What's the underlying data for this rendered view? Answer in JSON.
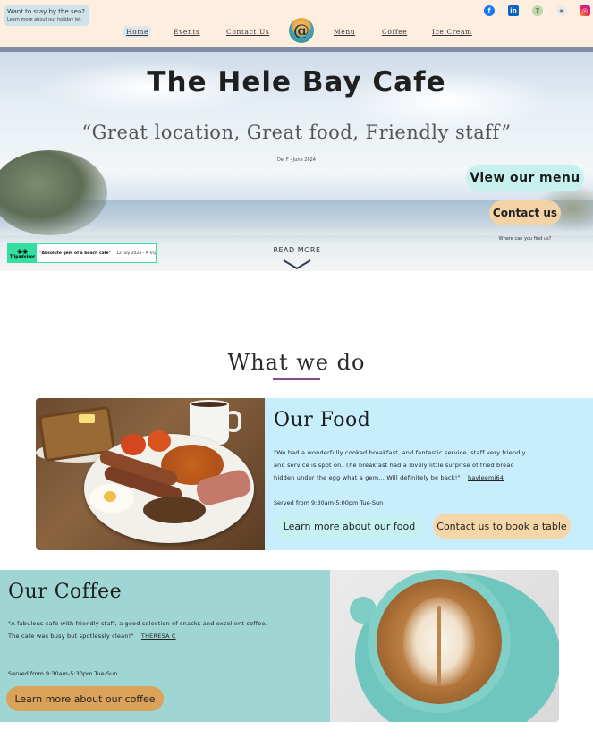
{
  "header": {
    "promo": {
      "title": "Want to stay by the sea?",
      "subtitle": "Learn more about our holiday let."
    },
    "nav": {
      "home": "Home",
      "events": "Events",
      "contact": "Contact Us",
      "menu": "Menu",
      "coffee": "Coffee",
      "ice_cream": "Ice Cream"
    },
    "logo_glyph": "@",
    "social_icons": [
      "facebook-icon",
      "linkedin-icon",
      "help-icon",
      "tripadvisor-icon",
      "instagram-icon"
    ]
  },
  "hero": {
    "title": "The Hele Bay Cafe",
    "quote": "“Great location, Great food, Friendly staff”",
    "cite": "Del F - June 2024",
    "view_menu": "View our menu",
    "contact": "Contact us",
    "find_us": "Where can you find us?",
    "read_more": "READ MORE",
    "tripadvisor": {
      "brand": "Tripadvisor",
      "quote": "\"Absolute gem of a beach cafe\"",
      "date": "12 July 2024 - A Tripa"
    }
  },
  "what_we_do": {
    "title": "What we do"
  },
  "food": {
    "heading": "Our Food",
    "review_lines": [
      "\"We had a wonderfully cooked breakfast, and fantastic service, staff very friendly",
      "and service is spot on. The breakfast had a lovely little surprise of fried bread",
      "hidden under the egg what a gem... Will definitely be back!\""
    ],
    "reviewer": "hayleemj64",
    "served": "Served from 9:30am-5:00pm Tue-Sun",
    "learn_more": "Learn more about our food",
    "book": "Contact us to book a table"
  },
  "coffee": {
    "heading": "Our Coffee",
    "review_lines": [
      "\"A fabulous cafe with friendly staff, a good selection of snacks and excellent coffee.",
      "The cafe was busy but spotlessly clean!\""
    ],
    "reviewer": "THERESA C",
    "served": "Served from 9:30am-5:30pm Tue-Sun",
    "learn_more": "Learn more about our coffee"
  },
  "colors": {
    "header_bg": "#fdeee0",
    "header_bar": "#7d8ca3",
    "aqua_button": "#c6f1ee",
    "peach_button": "#f3d3a6",
    "food_panel": "#c8eefd",
    "coffee_panel": "#9fd5d3",
    "coffee_button": "#dba35a",
    "underline_accent": "#8b4a8f"
  }
}
